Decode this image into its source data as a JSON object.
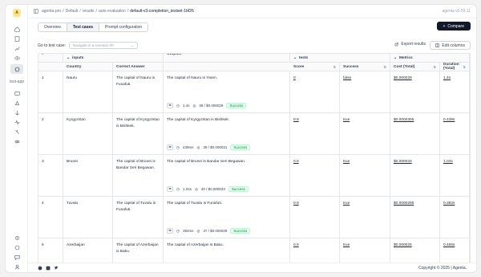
{
  "app": {
    "logo_letter": "A",
    "project_label": "test-app",
    "version": "agenta v0.59.11"
  },
  "breadcrumb": {
    "org": "agenta-pro",
    "workspace": "Default",
    "section": "results",
    "subsection": "auto evaluation",
    "current": "default-v3-completion_testset-1bf26"
  },
  "tabs": [
    {
      "label": "Overview"
    },
    {
      "label": "Test cases"
    },
    {
      "label": "Prompt configuration"
    }
  ],
  "actions": {
    "compare_label": "Compare",
    "export_label": "Export results",
    "edit_columns_label": "Edit columns"
  },
  "goto": {
    "label": "Go to test case:",
    "placeholder": "Navigate in a scenario #0"
  },
  "table": {
    "group_headers": {
      "inputs": "inputs",
      "outputs": "Outputs",
      "tests": "tests",
      "metrics": "Metrics"
    },
    "columns": {
      "num": "#",
      "country": "Country",
      "correct_answer": "Correct Answer",
      "score": "Score",
      "success": "Success",
      "cost": "Cost (Total)",
      "duration": "Duration (Total)"
    },
    "rows": [
      {
        "num": "1",
        "country": "Nauru",
        "correct_answer": "The capital of Nauru is Funafuti.",
        "output": "The capital of Nauru is Yaren.",
        "latency": "1.4s",
        "tokens_cost": "38 / $0.000029",
        "status": "Success",
        "score": "0",
        "success": "false",
        "cost": "$0.000029",
        "duration": "1.4s"
      },
      {
        "num": "2",
        "country": "Kyrgyzstan",
        "correct_answer": "The capital of Kyrgyzstan is Bishkek.",
        "output": "The capital of Kyrgyzstan is Bishkek.",
        "latency": "439ms",
        "tokens_cost": "39 / $0.000031",
        "status": "Success",
        "score": "0.9",
        "success": "true",
        "cost": "$0.0000305",
        "duration": "0.439s"
      },
      {
        "num": "3",
        "country": "Brunei",
        "correct_answer": "The capital of Brunei is Bandar Seri Begawan.",
        "output": "The capital of Brunei is Bandar Seri Begawan.",
        "latency": "1.04s",
        "tokens_cost": "40 / $0.000033",
        "status": "Success",
        "score": "0.9",
        "success": "true",
        "cost": "$0.000033",
        "duration": "1.04s"
      },
      {
        "num": "4",
        "country": "Tuvalu",
        "correct_answer": "The capital of Tuvalu is Funafuti.",
        "output": "The capital of Tuvalu is Funafuti.",
        "latency": "392ms",
        "tokens_cost": "37 / $0.000029",
        "status": "Success",
        "score": "0.9",
        "success": "true",
        "cost": "$0.0000285",
        "duration": "0.392s"
      },
      {
        "num": "5",
        "country": "Azerbaijan",
        "correct_answer": "The capital of Azerbaijan is Baku.",
        "output": "The capital of Azerbaijan is Baku.",
        "latency": "",
        "tokens_cost": "",
        "status": "",
        "score": "0.9",
        "success": "true",
        "cost": "$0.000025",
        "duration": "0.466s"
      }
    ]
  },
  "footer": {
    "copyright": "Copyright © 2025 | Agenta."
  }
}
